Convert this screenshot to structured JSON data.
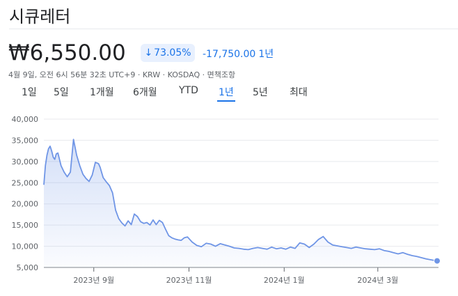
{
  "header": {
    "title": "시큐레터"
  },
  "quote": {
    "price": "₩6,550.00",
    "percent_change": "73.05%",
    "abs_change": "-17,750.00",
    "period": "1년",
    "meta": "4월 9일, 오전 6시 56분 32초 UTC+9 · KRW · KOSDAQ · 면책조항",
    "colors": {
      "accent": "#1a73e8",
      "line": "#6f95e6",
      "fill": "#e8eefc"
    }
  },
  "tabs": [
    "1일",
    "5일",
    "1개월",
    "6개월",
    "YTD",
    "1년",
    "5년",
    "최대"
  ],
  "active_tab": 5,
  "chart_data": {
    "type": "area",
    "ylim": [
      5000,
      40000
    ],
    "y_ticks": [
      5000,
      10000,
      15000,
      20000,
      25000,
      30000,
      35000,
      40000
    ],
    "y_tick_labels": [
      "5,000",
      "10,000",
      "15,000",
      "20,000",
      "25,000",
      "30,000",
      "35,000",
      "40,000"
    ],
    "x_tick_labels": [
      "2023년 9월",
      "2023년 11월",
      "2024년 1월",
      "2024년 3월"
    ],
    "x_tick_dates": [
      "2023-09-01",
      "2023-11-01",
      "2024-01-01",
      "2024-03-01"
    ],
    "x_range": [
      "2023-07-31",
      "2024-04-08"
    ],
    "grid": true,
    "series": [
      {
        "x": [
          "2023-07-31",
          "2023-08-01",
          "2023-08-02",
          "2023-08-03",
          "2023-08-04",
          "2023-08-05",
          "2023-08-06",
          "2023-08-07",
          "2023-08-08",
          "2023-08-09",
          "2023-08-11",
          "2023-08-13",
          "2023-08-15",
          "2023-08-17",
          "2023-08-19",
          "2023-08-21",
          "2023-08-23",
          "2023-08-25",
          "2023-08-27",
          "2023-08-29",
          "2023-08-31",
          "2023-09-02",
          "2023-09-04",
          "2023-09-05",
          "2023-09-07",
          "2023-09-09",
          "2023-09-11",
          "2023-09-13",
          "2023-09-15",
          "2023-09-17",
          "2023-09-19",
          "2023-09-21",
          "2023-09-23",
          "2023-09-25",
          "2023-09-27",
          "2023-09-29",
          "2023-10-01",
          "2023-10-03",
          "2023-10-05",
          "2023-10-07",
          "2023-10-09",
          "2023-10-11",
          "2023-10-13",
          "2023-10-15",
          "2023-10-17",
          "2023-10-19",
          "2023-10-21",
          "2023-10-23",
          "2023-10-25",
          "2023-10-27",
          "2023-10-29",
          "2023-10-31",
          "2023-11-03",
          "2023-11-06",
          "2023-11-09",
          "2023-11-12",
          "2023-11-15",
          "2023-11-18",
          "2023-11-21",
          "2023-11-24",
          "2023-11-27",
          "2023-11-30",
          "2023-12-03",
          "2023-12-06",
          "2023-12-09",
          "2023-12-12",
          "2023-12-15",
          "2023-12-18",
          "2023-12-21",
          "2023-12-24",
          "2023-12-27",
          "2023-12-30",
          "2024-01-02",
          "2024-01-05",
          "2024-01-08",
          "2024-01-11",
          "2024-01-14",
          "2024-01-17",
          "2024-01-20",
          "2024-01-23",
          "2024-01-26",
          "2024-01-29",
          "2024-02-01",
          "2024-02-04",
          "2024-02-07",
          "2024-02-10",
          "2024-02-13",
          "2024-02-16",
          "2024-02-19",
          "2024-02-22",
          "2024-02-25",
          "2024-02-28",
          "2024-03-02",
          "2024-03-05",
          "2024-03-08",
          "2024-03-11",
          "2024-03-14",
          "2024-03-17",
          "2024-03-20",
          "2024-03-23",
          "2024-03-26",
          "2024-03-29",
          "2024-04-01",
          "2024-04-04",
          "2024-04-08"
        ],
        "y": [
          24500,
          29000,
          31500,
          33000,
          33600,
          32500,
          31000,
          30500,
          31800,
          32000,
          29000,
          27500,
          26400,
          27500,
          35200,
          31500,
          29000,
          27000,
          26000,
          25300,
          26800,
          29800,
          29500,
          28700,
          26200,
          25200,
          24300,
          22600,
          18500,
          16500,
          15500,
          14800,
          16000,
          15100,
          17600,
          17000,
          15800,
          15400,
          15600,
          15000,
          16200,
          15100,
          16100,
          15600,
          14000,
          12500,
          12000,
          11700,
          11500,
          11400,
          12000,
          12200,
          11000,
          10200,
          9900,
          10700,
          10500,
          10000,
          10600,
          10300,
          10000,
          9600,
          9500,
          9300,
          9200,
          9500,
          9700,
          9500,
          9300,
          9800,
          9400,
          9600,
          9300,
          9800,
          9500,
          10800,
          10500,
          9700,
          10500,
          11600,
          12300,
          11000,
          10300,
          10100,
          9900,
          9700,
          9500,
          9800,
          9600,
          9400,
          9300,
          9200,
          9400,
          9000,
          8800,
          8500,
          8200,
          8500,
          8100,
          7800,
          7600,
          7300,
          7000,
          6800,
          6550
        ]
      }
    ]
  }
}
